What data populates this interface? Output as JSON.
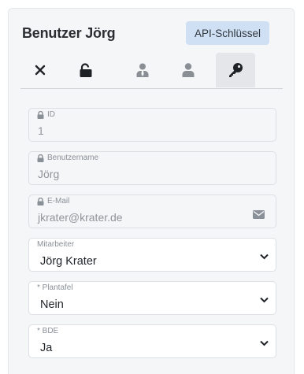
{
  "header": {
    "title": "Benutzer Jörg",
    "api_button_label": "API-Schlüssel"
  },
  "tabs": [
    {
      "icon": "close-icon"
    },
    {
      "icon": "unlock-icon"
    },
    {
      "icon": "user-tie-icon"
    },
    {
      "icon": "user-icon"
    },
    {
      "icon": "key-icon",
      "active": true
    }
  ],
  "fields": {
    "id": {
      "label": "ID",
      "value": "1",
      "locked": true
    },
    "username": {
      "label": "Benutzername",
      "value": "Jörg",
      "locked": true
    },
    "email": {
      "label": "E-Mail",
      "value": "jkrater@krater.de",
      "locked": true,
      "icon": "envelope-icon"
    },
    "employee": {
      "label": "Mitarbeiter",
      "value": "Jörg Krater"
    },
    "plantafel": {
      "label": "* Plantafel",
      "value": "Nein"
    },
    "bde": {
      "label": "* BDE",
      "value": "Ja"
    }
  }
}
